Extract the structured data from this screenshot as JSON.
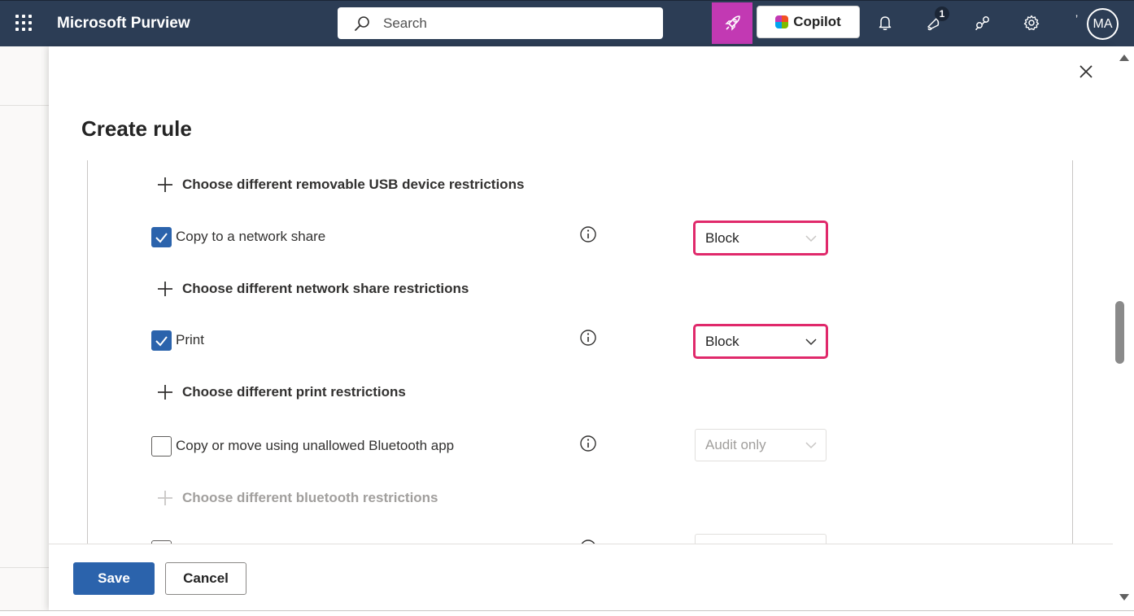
{
  "app": {
    "name": "Microsoft Purview",
    "search_placeholder": "Search",
    "copilot_label": "Copilot",
    "notification_count": "1",
    "avatar_initials": "MA",
    "apostrophe": "’"
  },
  "panel": {
    "title": "Create rule",
    "rows": [
      {
        "type": "expander",
        "label": "Choose different removable USB device restrictions",
        "disabled": false
      },
      {
        "type": "setting",
        "label": "Copy to a network share",
        "checked": true,
        "dropdown_value": "Block",
        "highlighted": true
      },
      {
        "type": "expander",
        "label": "Choose different network share restrictions",
        "disabled": false
      },
      {
        "type": "setting",
        "label": "Print",
        "checked": true,
        "dropdown_value": "Block",
        "highlighted": true
      },
      {
        "type": "expander",
        "label": "Choose different print restrictions",
        "disabled": false
      },
      {
        "type": "setting",
        "label": "Copy or move using unallowed Bluetooth app",
        "checked": false,
        "dropdown_value": "Audit only",
        "highlighted": false
      },
      {
        "type": "expander",
        "label": "Choose different bluetooth restrictions",
        "disabled": true
      }
    ],
    "footer": {
      "save_label": "Save",
      "cancel_label": "Cancel"
    }
  },
  "colors": {
    "topbar": "#2c3d55",
    "accent": "#2b63ac",
    "highlight": "#e0296b",
    "rocket": "#c239b3"
  }
}
